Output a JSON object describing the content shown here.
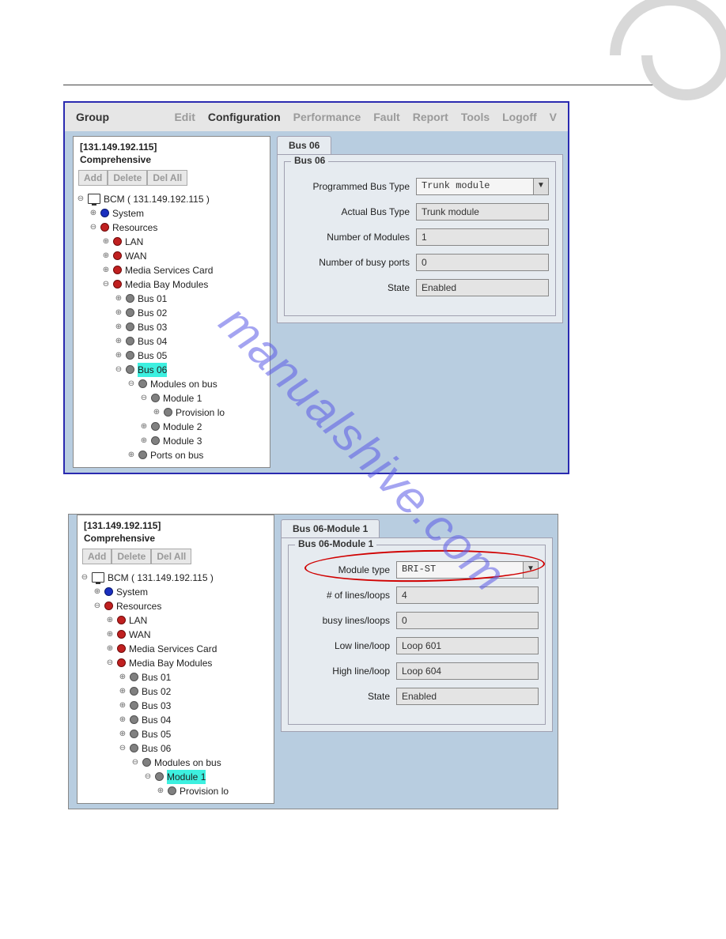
{
  "watermark": "manualshive.com",
  "menubar": {
    "group": "Group",
    "items": [
      "Edit",
      "Configuration",
      "Performance",
      "Fault",
      "Report",
      "Tools",
      "Logoff",
      "V"
    ],
    "active_index": 1
  },
  "left": {
    "ip": "[131.149.192.115]",
    "mode": "Comprehensive",
    "buttons": {
      "add": "Add",
      "delete": "Delete",
      "delall": "Del All"
    },
    "root": "BCM ( 131.149.192.115 )",
    "system": "System",
    "resources": "Resources",
    "lan": "LAN",
    "wan": "WAN",
    "msc": "Media Services Card",
    "mbm": "Media Bay Modules",
    "buses": [
      "Bus 01",
      "Bus 02",
      "Bus 03",
      "Bus 04",
      "Bus 05",
      "Bus 06"
    ],
    "mob": "Modules on bus",
    "mods": [
      "Module 1",
      "Module 2",
      "Module 3"
    ],
    "prov": "Provision lo",
    "prov2": "Provision lo",
    "pob": "Ports on bus"
  },
  "panel1": {
    "tab": "Bus 06",
    "legend": "Bus 06",
    "fields": {
      "pbt_label": "Programmed Bus Type",
      "pbt_value": "Trunk module",
      "abt_label": "Actual Bus Type",
      "abt_value": "Trunk module",
      "nm_label": "Number of Modules",
      "nm_value": "1",
      "nbp_label": "Number of busy ports",
      "nbp_value": "0",
      "st_label": "State",
      "st_value": "Enabled"
    }
  },
  "panel2": {
    "tab": "Bus 06-Module 1",
    "legend": "Bus 06-Module 1",
    "fields": {
      "mt_label": "Module type",
      "mt_value": "BRI-ST",
      "nl_label": "# of lines/loops",
      "nl_value": "4",
      "bl_label": "busy lines/loops",
      "bl_value": "0",
      "ll_label": "Low line/loop",
      "ll_value": "Loop 601",
      "hl_label": "High line/loop",
      "hl_value": "Loop 604",
      "st_label": "State",
      "st_value": "Enabled"
    }
  }
}
